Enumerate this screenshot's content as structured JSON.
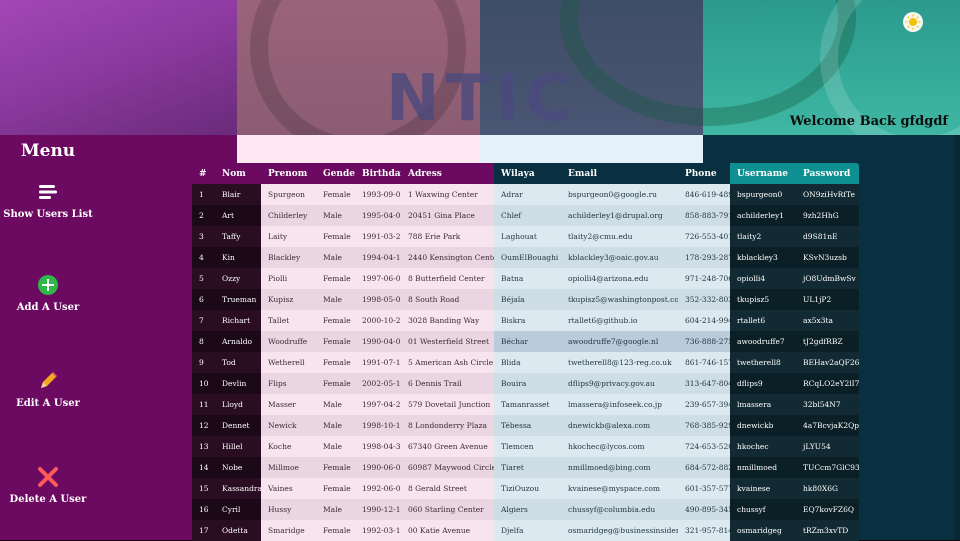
{
  "header": {
    "welcome": "Welcome Back gfdgdf",
    "logo_text": "NTIC",
    "theme_toggle_icon": "sun-icon"
  },
  "sidebar": {
    "title": "Menu",
    "items": [
      {
        "label": "Show Users List",
        "icon": "list-icon"
      },
      {
        "label": "Add A User",
        "icon": "plus-circle-icon"
      },
      {
        "label": "Edit A User",
        "icon": "pencil-icon"
      },
      {
        "label": "Delete A User",
        "icon": "x-icon"
      }
    ]
  },
  "table": {
    "columns": [
      "#",
      "Nom",
      "Prenom",
      "Gender",
      "Birthday",
      "Adress",
      "Wilaya",
      "Email",
      "Phone",
      "Username",
      "Password"
    ],
    "rows": [
      [
        "1",
        "Blair",
        "Spurgeon",
        "Female",
        "1993-09-05",
        "1 Waxwing Center",
        "Adrar",
        "bspurgeon0@google.ru",
        "846-619-4895",
        "bspurgeon0",
        "ON9ziHvRfTe"
      ],
      [
        "2",
        "Art",
        "Childerley",
        "Male",
        "1995-04-09",
        "20451 Gina Place",
        "Chlef",
        "achilderley1@drupal.org",
        "858-883-7917",
        "achilderley1",
        "9zh2HhG"
      ],
      [
        "3",
        "Taffy",
        "Laity",
        "Female",
        "1991-03-26",
        "788 Erie Park",
        "Laghouat",
        "tlaity2@cmu.edu",
        "726-553-4019",
        "tlaity2",
        "d9S81nE"
      ],
      [
        "4",
        "Kin",
        "Blackley",
        "Male",
        "1994-04-12",
        "2440 Kensington Center",
        "OumElBouaghi",
        "kblackley3@oaic.gov.au",
        "178-293-2873",
        "kblackley3",
        "KSvN3uzsb"
      ],
      [
        "5",
        "Ozzy",
        "Piolli",
        "Female",
        "1997-06-08",
        "8 Butterfield Center",
        "Batna",
        "opiolli4@arizona.edu",
        "971-248-7060",
        "opiolli4",
        "jO8UdmBwSv"
      ],
      [
        "6",
        "Trueman",
        "Kupisz",
        "Male",
        "1998-05-01",
        "8 South Road",
        "Béjaïa",
        "tkupisz5@washingtonpost.com",
        "352-332-8038",
        "tkupisz5",
        "UL1jP2"
      ],
      [
        "7",
        "Richart",
        "Tallet",
        "Female",
        "2000-10-29",
        "3028 Banding Way",
        "Biskra",
        "rtallet6@github.io",
        "604-214-9940",
        "rtallet6",
        "ax5x3ta"
      ],
      [
        "8",
        "Arnaldo",
        "Woodruffe",
        "Female",
        "1990-04-09",
        "01 Westerfield Street",
        "Béchar",
        "awoodruffe7@google.nl",
        "736-888-2752",
        "awoodruffe7",
        "tJ2gdfRBZ"
      ],
      [
        "9",
        "Tod",
        "Wetherell",
        "Female",
        "1991-07-13",
        "5 American Ash Circle",
        "Blida",
        "twetherell8@123-reg.co.uk",
        "861-746-1574",
        "twetherell8",
        "BEHav2aQF26s"
      ],
      [
        "10",
        "Devlin",
        "Flips",
        "Female",
        "2002-05-15",
        "6 Dennis Trail",
        "Bouira",
        "dflips9@privacy.gov.au",
        "313-647-8044",
        "dflips9",
        "RCqLO2eY2lI7"
      ],
      [
        "11",
        "Lloyd",
        "Masser",
        "Male",
        "1997-04-20",
        "579 Dovetail Junction",
        "Tamanrasset",
        "lmassera@infoseek.co.jp",
        "239-657-3943",
        "lmassera",
        "32bl54N7"
      ],
      [
        "12",
        "Dennet",
        "Newick",
        "Male",
        "1998-10-19",
        "8 Londonderry Plaza",
        "Tébessa",
        "dnewickb@alexa.com",
        "768-385-9297",
        "dnewickb",
        "4a7BcvjaK2Qp"
      ],
      [
        "13",
        "Hillel",
        "Koche",
        "Male",
        "1998-04-30",
        "67340 Green Avenue",
        "Tlemcen",
        "hkochec@lycos.com",
        "724-653-5206",
        "hkochec",
        "jLYU54"
      ],
      [
        "14",
        "Nobe",
        "Millmoe",
        "Female",
        "1990-06-03",
        "60987 Maywood Circle",
        "Tiaret",
        "nmillmoed@bing.com",
        "684-572-8822",
        "nmillmoed",
        "TUCcm7GlC93L"
      ],
      [
        "15",
        "Kassandra",
        "Vaines",
        "Female",
        "1992-06-06",
        "8 Gerald Street",
        "TiziOuzou",
        "kvainese@myspace.com",
        "601-357-5770",
        "kvainese",
        "hk80X6G"
      ],
      [
        "16",
        "Cyril",
        "Hussy",
        "Male",
        "1990-12-11",
        "060 Starling Center",
        "Algiers",
        "chussyf@columbia.edu",
        "490-895-3451",
        "chussyf",
        "EQ7kovFZ6Q"
      ],
      [
        "17",
        "Odetta",
        "Smaridge",
        "Female",
        "1992-03-18",
        "00 Katie Avenue",
        "Djelfa",
        "osmaridgeg@businessinsider.com",
        "321-957-8147",
        "osmaridgeg",
        "tRZm3xvTD"
      ]
    ]
  },
  "colors": {
    "sidebar": "#6c0a61",
    "band_pink": "#fde8f3",
    "band_blue": "#e4f1fa",
    "band_dark_teal": "#083040",
    "header_teal": "#0e8f92"
  }
}
